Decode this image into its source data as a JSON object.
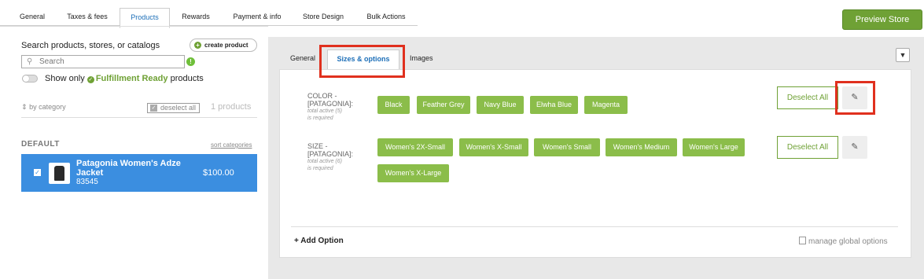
{
  "top_tabs": [
    {
      "label": "General"
    },
    {
      "label": "Taxes & fees"
    },
    {
      "label": "Products"
    },
    {
      "label": "Rewards"
    },
    {
      "label": "Payment & info"
    },
    {
      "label": "Store Design"
    },
    {
      "label": "Bulk Actions"
    }
  ],
  "preview_button": "Preview Store",
  "left": {
    "search_label": "Search products, stores, or catalogs",
    "create_product": "create product",
    "search_placeholder": "Search",
    "toggle_prefix": "Show only",
    "toggle_highlight": "Fulfillment Ready",
    "toggle_suffix": "products",
    "by_category": "by category",
    "deselect_all": "deselect all",
    "product_count": "1 products",
    "group_label": "DEFAULT",
    "sort_categories": "sort categories",
    "product": {
      "name": "Patagonia Women's Adze Jacket",
      "sku": "83545",
      "price": "$100.00"
    }
  },
  "sub_tabs": [
    {
      "label": "General"
    },
    {
      "label": "Sizes & options"
    },
    {
      "label": "Images"
    }
  ],
  "options": [
    {
      "label_line1": "COLOR -",
      "label_line2": "[PATAGONIA]:",
      "total_active": "total active (5)",
      "required": "is required",
      "values": [
        "Black",
        "Feather Grey",
        "Navy Blue",
        "Elwha Blue",
        "Magenta"
      ],
      "deselect_label": "Deselect All"
    },
    {
      "label_line1": "SIZE -",
      "label_line2": "[PATAGONIA]:",
      "total_active": "total active (6)",
      "required": "is required",
      "values": [
        "Women's 2X-Small",
        "Women's X-Small",
        "Women's Small",
        "Women's Medium",
        "Women's Large",
        "Women's X-Large"
      ],
      "deselect_label": "Deselect All"
    }
  ],
  "add_option": "+ Add Option",
  "manage_global": "manage global options",
  "icons": {
    "edit": "pencil-icon",
    "collapse": "chevron-down-icon",
    "search": "search-icon"
  },
  "colors": {
    "accent_green": "#8bbd4a",
    "selected_blue": "#3b8ee0",
    "highlight_red": "#e0301e"
  }
}
